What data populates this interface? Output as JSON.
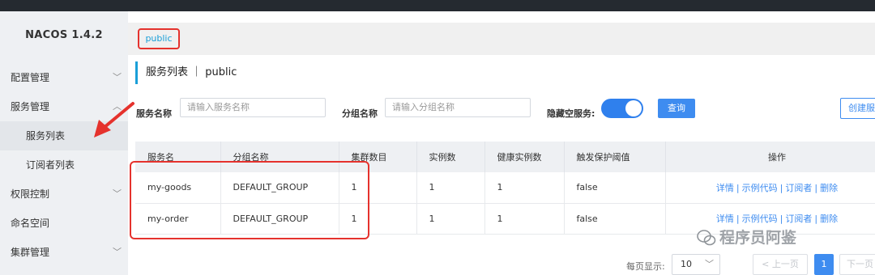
{
  "sidebar": {
    "logo": "NACOS 1.4.2",
    "items": [
      {
        "label": "配置管理",
        "chevron": "﹀"
      },
      {
        "label": "服务管理",
        "chevron": "︿"
      },
      {
        "label": "服务列表"
      },
      {
        "label": "订阅者列表"
      },
      {
        "label": "权限控制",
        "chevron": "﹀"
      },
      {
        "label": "命名空间"
      },
      {
        "label": "集群管理",
        "chevron": "﹀"
      }
    ]
  },
  "namespace": {
    "active": "public"
  },
  "page": {
    "title": "服务列表 ｜ public"
  },
  "filters": {
    "service_name_label": "服务名称",
    "service_name_placeholder": "请输入服务名称",
    "group_name_label": "分组名称",
    "group_name_placeholder": "请输入分组名称",
    "hide_empty_label": "隐藏空服务:",
    "hide_empty_on": true,
    "query_button": "查询",
    "create_button": "创建服务"
  },
  "table": {
    "headers": [
      "服务名",
      "分组名称",
      "集群数目",
      "实例数",
      "健康实例数",
      "触发保护阈值",
      "操作"
    ],
    "rows": [
      {
        "name": "my-goods",
        "group": "DEFAULT_GROUP",
        "clusters": "1",
        "instances": "1",
        "healthy": "1",
        "threshold": "false"
      },
      {
        "name": "my-order",
        "group": "DEFAULT_GROUP",
        "clusters": "1",
        "instances": "1",
        "healthy": "1",
        "threshold": "false"
      }
    ],
    "actions": [
      "详情",
      "示例代码",
      "订阅者",
      "删除"
    ],
    "separator": "|"
  },
  "pagination": {
    "page_size_label": "每页显示:",
    "page_size": "10",
    "prev": "< 上一页",
    "current_page": "1",
    "next": "下一页 >"
  },
  "watermark": {
    "text": "程序员阿鉴"
  },
  "colors": {
    "accent": "#3e8cf0",
    "annotation": "#e5322d",
    "namespace_text": "#1a9fd8"
  }
}
